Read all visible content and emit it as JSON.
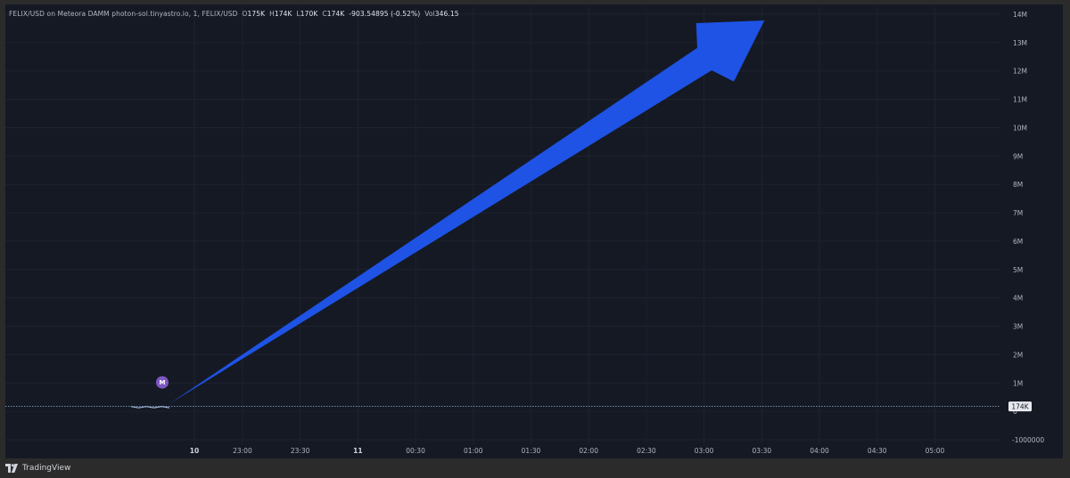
{
  "header": {
    "symbol": "FELIX/USD on Meteora DAMM photon-sol.tinyastro.io, 1, FELIX/USD",
    "open_label": "O",
    "open": "175K",
    "high_label": "H",
    "high": "174K",
    "low_label": "L",
    "low": "170K",
    "close_label": "C",
    "close": "174K",
    "change": "-903.54895 (-0.52%)",
    "vol_label": "Vol",
    "vol": "346.15"
  },
  "marker": {
    "letter": "M"
  },
  "price_badge": "174K",
  "brand": "TradingView",
  "colors": {
    "arrow": "#1e53e5",
    "marker": "#7e57c2",
    "background": "#151924",
    "grid": "#1f2331"
  },
  "chart_data": {
    "type": "line",
    "y_ticks": [
      "14M",
      "13M",
      "12M",
      "11M",
      "10M",
      "9M",
      "8M",
      "7M",
      "6M",
      "5M",
      "4M",
      "3M",
      "2M",
      "1M",
      "0",
      "-1000000"
    ],
    "y_tick_values": [
      14000000,
      13000000,
      12000000,
      11000000,
      10000000,
      9000000,
      8000000,
      7000000,
      6000000,
      5000000,
      4000000,
      3000000,
      2000000,
      1000000,
      0,
      -1000000
    ],
    "ylim": [
      -1000000,
      14000000
    ],
    "x_ticks": [
      "10",
      "23:00",
      "23:30",
      "11",
      "00:30",
      "01:00",
      "01:30",
      "02:00",
      "02:30",
      "03:00",
      "03:30",
      "04:00",
      "04:30",
      "05:00"
    ],
    "x_tick_bold": [
      "10",
      "11"
    ],
    "last_price": 174000,
    "series": [
      {
        "x": [
          "22:02",
          "22:06",
          "22:10",
          "22:14",
          "22:18",
          "22:22"
        ],
        "values": [
          170000,
          172000,
          171000,
          173000,
          175000,
          174000
        ]
      }
    ],
    "annotation": {
      "type": "arrow",
      "start": {
        "x": "22:22",
        "y": 174000
      },
      "end": {
        "x": "03:30",
        "y": 14000000
      }
    }
  }
}
